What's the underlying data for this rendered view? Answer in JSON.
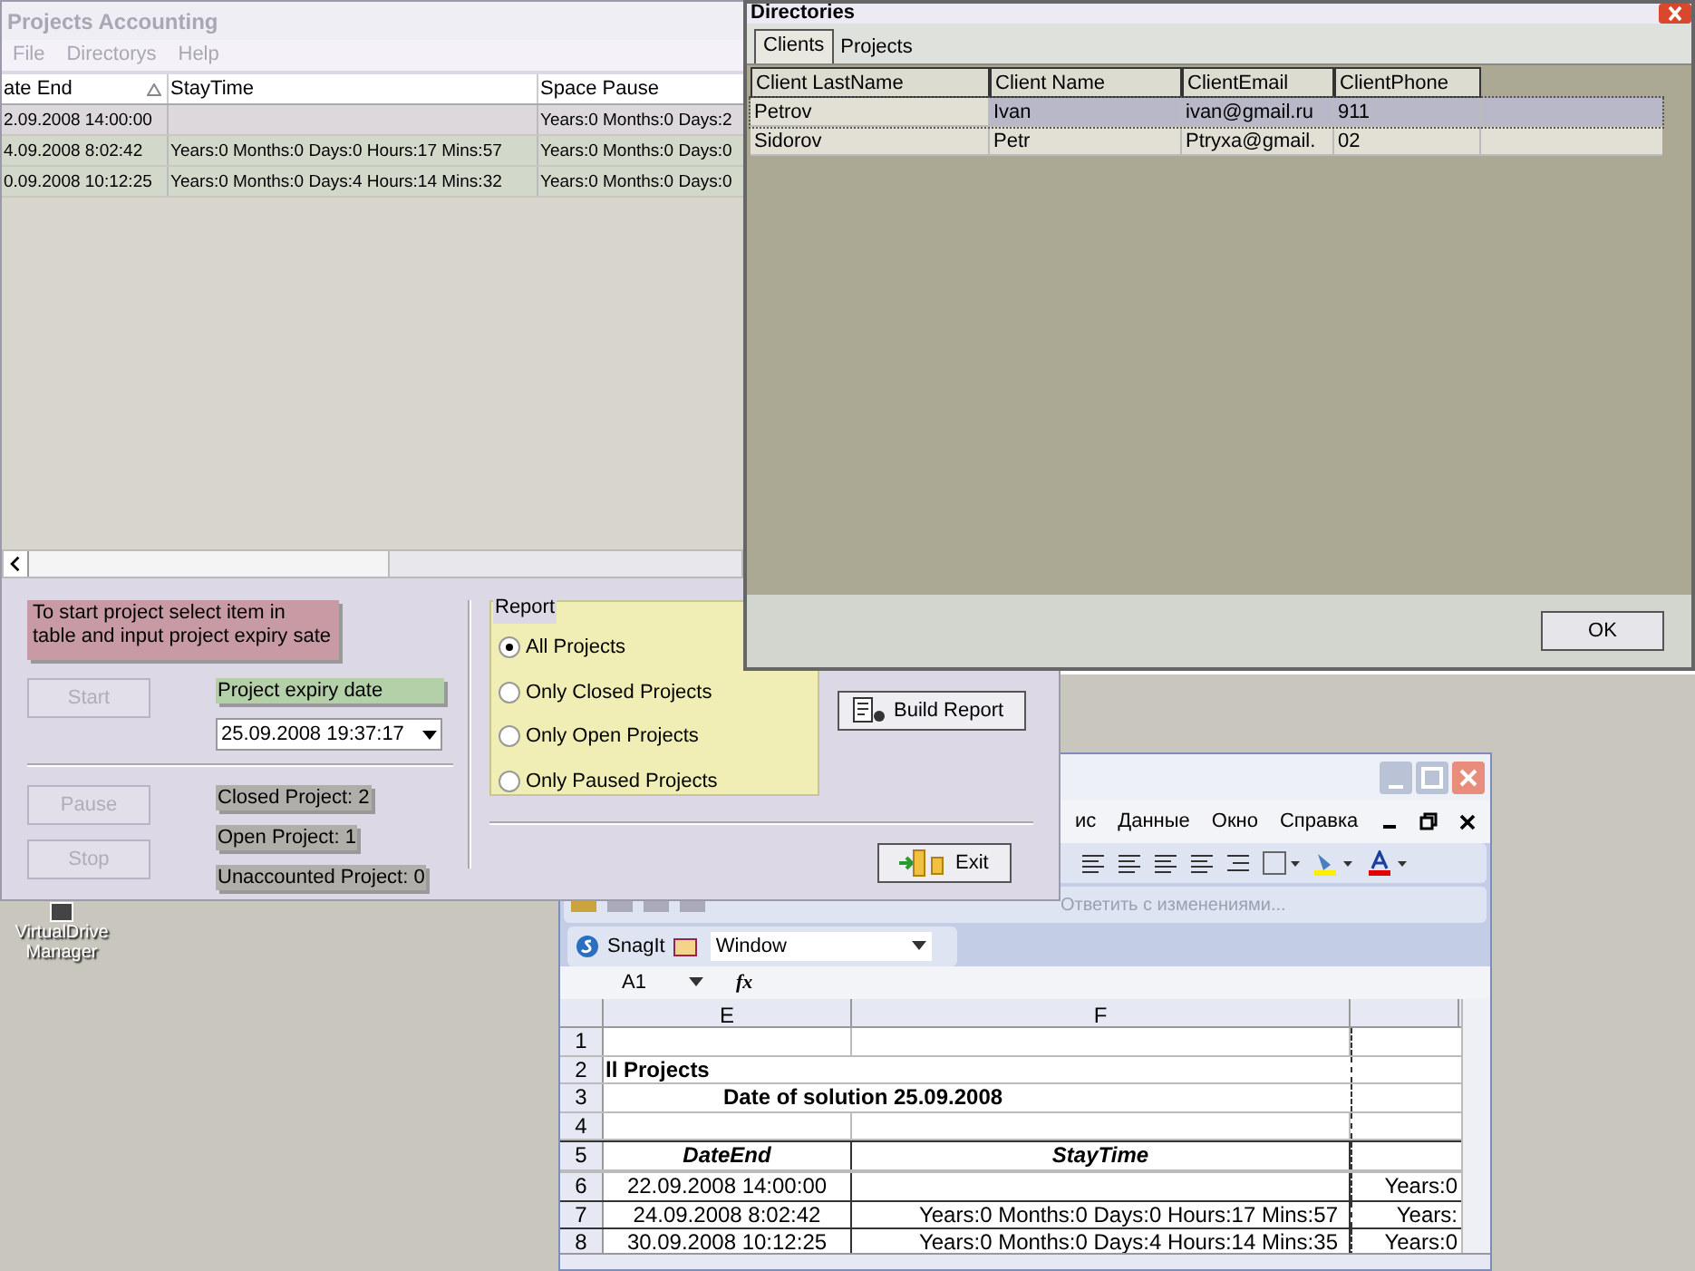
{
  "desktop": {
    "icons": [
      {
        "label": "VirtualDrive Manager"
      }
    ]
  },
  "excel_window": {
    "menu": [
      "ис",
      "Данные",
      "Окно",
      "Справка"
    ],
    "review_toolbar": "Ответить с изменениями...",
    "snagit": {
      "label": "SnagIt",
      "combo": "Window"
    },
    "name_box": "A1",
    "formula_label": "fx",
    "columns": [
      "E",
      "F",
      ""
    ],
    "rows": [
      {
        "number": "1",
        "kind": "blank",
        "cells": []
      },
      {
        "number": "2",
        "kind": "title",
        "cells": [
          "ll Projects"
        ]
      },
      {
        "number": "3",
        "kind": "subtitle",
        "cells": [
          "Date of solution 25.09.2008"
        ]
      },
      {
        "number": "4",
        "kind": "blank",
        "cells": []
      },
      {
        "number": "5",
        "kind": "header",
        "cells": [
          "DateEnd",
          "StayTime",
          ""
        ]
      },
      {
        "number": "6",
        "kind": "data",
        "cells": [
          "22.09.2008 14:00:00",
          "",
          "Years:0"
        ]
      },
      {
        "number": "7",
        "kind": "data",
        "cells": [
          "24.09.2008 8:02:42",
          "Years:0 Months:0 Days:0 Hours:17 Mins:57",
          "Years:"
        ]
      },
      {
        "number": "8",
        "kind": "data",
        "cells": [
          "30.09.2008 10:12:25",
          "Years:0 Months:0 Days:4 Hours:14 Mins:35",
          "Years:0"
        ]
      }
    ]
  },
  "projects_window": {
    "title": "Projects Accounting",
    "menu": [
      "File",
      "Directorys",
      "Help"
    ],
    "table": {
      "columns": [
        {
          "label": "ate End",
          "sorted": true
        },
        {
          "label": "StayTime",
          "sorted": false
        },
        {
          "label": "Space Pause",
          "sorted": false
        }
      ],
      "rows": [
        {
          "color": "#dcd8dc",
          "cells": [
            "2.09.2008 14:00:00",
            "",
            "Years:0 Months:0 Days:2"
          ]
        },
        {
          "color": "#d3d9ca",
          "cells": [
            "4.09.2008 8:02:42",
            "Years:0 Months:0 Days:0 Hours:17 Mins:57",
            "Years:0 Months:0 Days:0"
          ]
        },
        {
          "color": "#d3d9ca",
          "cells": [
            "0.09.2008 10:12:25",
            "Years:0 Months:0 Days:4 Hours:14 Mins:32",
            "Years:0 Months:0 Days:0"
          ]
        }
      ]
    },
    "hint": "To start project select item in table and input project expiry sate",
    "start_button": {
      "label": "Start",
      "disabled": true
    },
    "expiry_label": "Project expiry date",
    "expiry_value": "25.09.2008 19:37:17",
    "pause_button": {
      "label": "Pause",
      "disabled": true
    },
    "stop_button": {
      "label": "Stop",
      "disabled": true
    },
    "counters": [
      "Closed Project: 2",
      "Open Project: 1",
      "Unaccounted Project: 0"
    ],
    "report": {
      "title": "Report",
      "options": [
        {
          "label": "All Projects",
          "selected": true
        },
        {
          "label": "Only Closed Projects",
          "selected": false
        },
        {
          "label": "Only Open Projects",
          "selected": false
        },
        {
          "label": "Only Paused Projects",
          "selected": false
        }
      ]
    },
    "build_report_button": "Build Report",
    "exit_button": "Exit"
  },
  "directories_window": {
    "title": "Directories",
    "tabs": [
      {
        "label": "Clients",
        "selected": true
      },
      {
        "label": "Projects",
        "selected": false
      }
    ],
    "table": {
      "columns": [
        "Client LastName",
        "Client Name",
        "ClientEmail",
        "ClientPhone"
      ],
      "rows": [
        {
          "selected": true,
          "cells": [
            "Petrov",
            "Ivan",
            "ivan@gmail.ru",
            "911"
          ]
        },
        {
          "selected": false,
          "cells": [
            "Sidorov",
            "Petr",
            "Ptryxa@gmail.",
            "02"
          ]
        }
      ]
    },
    "ok_button": "OK"
  }
}
